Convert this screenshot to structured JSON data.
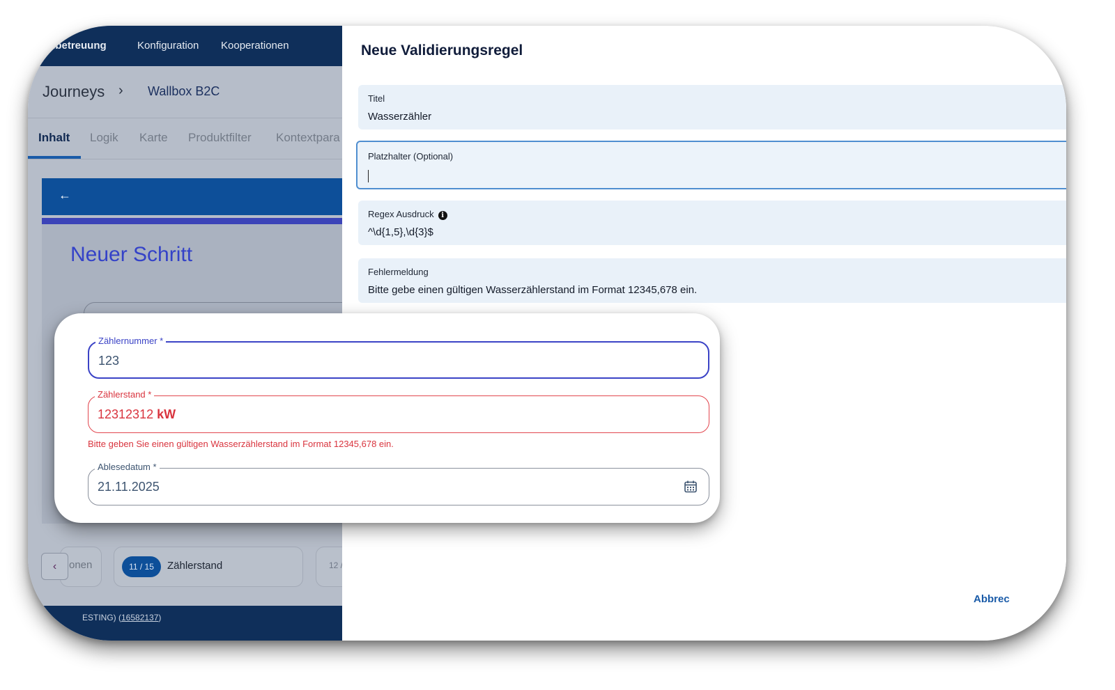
{
  "topnav": {
    "item1": "mbetreuung",
    "item2": "Konfiguration",
    "item3": "Kooperationen"
  },
  "breadcrumb": {
    "root": "Journeys",
    "separator": "›",
    "current": "Wallbox B2C"
  },
  "tabs": [
    "Inhalt",
    "Logik",
    "Karte",
    "Produktfilter",
    "Kontextpara"
  ],
  "step": {
    "back_icon": "arrow-left-icon",
    "title": "Neuer Schritt"
  },
  "stepper": {
    "prev_icon": "chevron-left-icon",
    "prev_label": "onen",
    "current_badge": "11 / 15",
    "current_label": "Zählerstand",
    "next_badge": "12 /"
  },
  "footer": {
    "prefix": "ESTING) (",
    "link": "16582137",
    "suffix": ")"
  },
  "drawer": {
    "title": "Neue Validierungsregel",
    "fields": {
      "title": {
        "label": "Titel",
        "value": "Wasserzähler"
      },
      "placeholder": {
        "label": "Platzhalter (Optional)",
        "value": ""
      },
      "regex": {
        "label": "Regex Ausdruck",
        "info_icon": "info-icon",
        "value": "^\\d{1,5},\\d{3}$"
      },
      "error": {
        "label": "Fehlermeldung",
        "value": "Bitte gebe einen gültigen Wasserzählerstand im Format 12345,678 ein."
      }
    },
    "cancel_label": "Abbrec"
  },
  "card": {
    "meter_number": {
      "label": "Zählernummer *",
      "value": "123"
    },
    "meter_reading": {
      "label": "Zählerstand *",
      "value": "12312312",
      "unit": "kW"
    },
    "error_message": "Bitte geben Sie einen gültigen Wasserzählerstand im Format 12345,678 ein.",
    "reading_date": {
      "label": "Ablesedatum *",
      "value": "21.11.2025",
      "icon": "calendar-icon"
    }
  },
  "colors": {
    "navy": "#0f2f5a",
    "primary_blue": "#0d4f99",
    "accent_violet": "#3b43c6",
    "error_red": "#d9343e",
    "field_bg": "#e9f1f9"
  }
}
